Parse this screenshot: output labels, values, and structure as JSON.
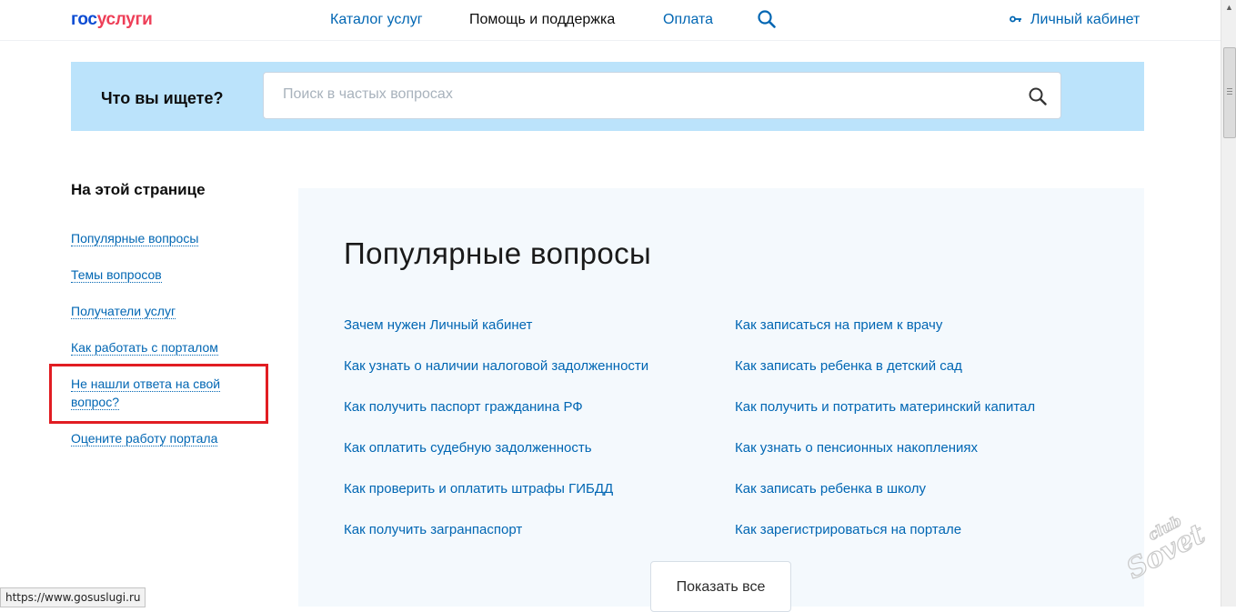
{
  "header": {
    "logo_gos": "гос",
    "logo_uslugi": "услуги",
    "nav": {
      "catalog": "Каталог услуг",
      "help": "Помощь и поддержка",
      "payment": "Оплата"
    },
    "cabinet": "Личный кабинет"
  },
  "banner": {
    "title": "Что вы ищете?",
    "placeholder": "Поиск в частых вопросах"
  },
  "sidebar": {
    "title": "На этой странице",
    "items": [
      {
        "label": "Популярные вопросы"
      },
      {
        "label": "Темы вопросов"
      },
      {
        "label": "Получатели услуг"
      },
      {
        "label": "Как работать с порталом"
      },
      {
        "label_line1": "Не нашли ответа на свой",
        "label_line2": "вопрос?"
      },
      {
        "label": "Оцените работу портала"
      }
    ]
  },
  "main": {
    "title": "Популярные вопросы",
    "left_questions": [
      "Зачем нужен Личный кабинет",
      "Как узнать о наличии налоговой задолженности",
      "Как получить паспорт гражданина РФ",
      "Как оплатить судебную задолженность",
      "Как проверить и оплатить штрафы ГИБДД",
      "Как получить загранпаспорт"
    ],
    "right_questions": [
      "Как записаться на прием к врачу",
      "Как записать ребенка в детский сад",
      "Как получить и потратить материнский капитал",
      "Как узнать о пенсионных накоплениях",
      "Как записать ребенка в школу",
      "Как зарегистрироваться на портале"
    ],
    "show_all": "Показать все"
  },
  "statusbar": {
    "url": "https://www.gosuslugi.ru"
  },
  "watermark": {
    "line1": "club",
    "line2": "Sovet"
  },
  "colors": {
    "link": "#0066b3",
    "banner_bg": "#bbe3fb",
    "panel_bg": "#f4f9fd",
    "highlight": "#e11d22",
    "logo_blue": "#0d4cd3",
    "logo_red": "#ee3f58"
  },
  "icons": {
    "search": "search-icon",
    "key": "key-icon"
  }
}
